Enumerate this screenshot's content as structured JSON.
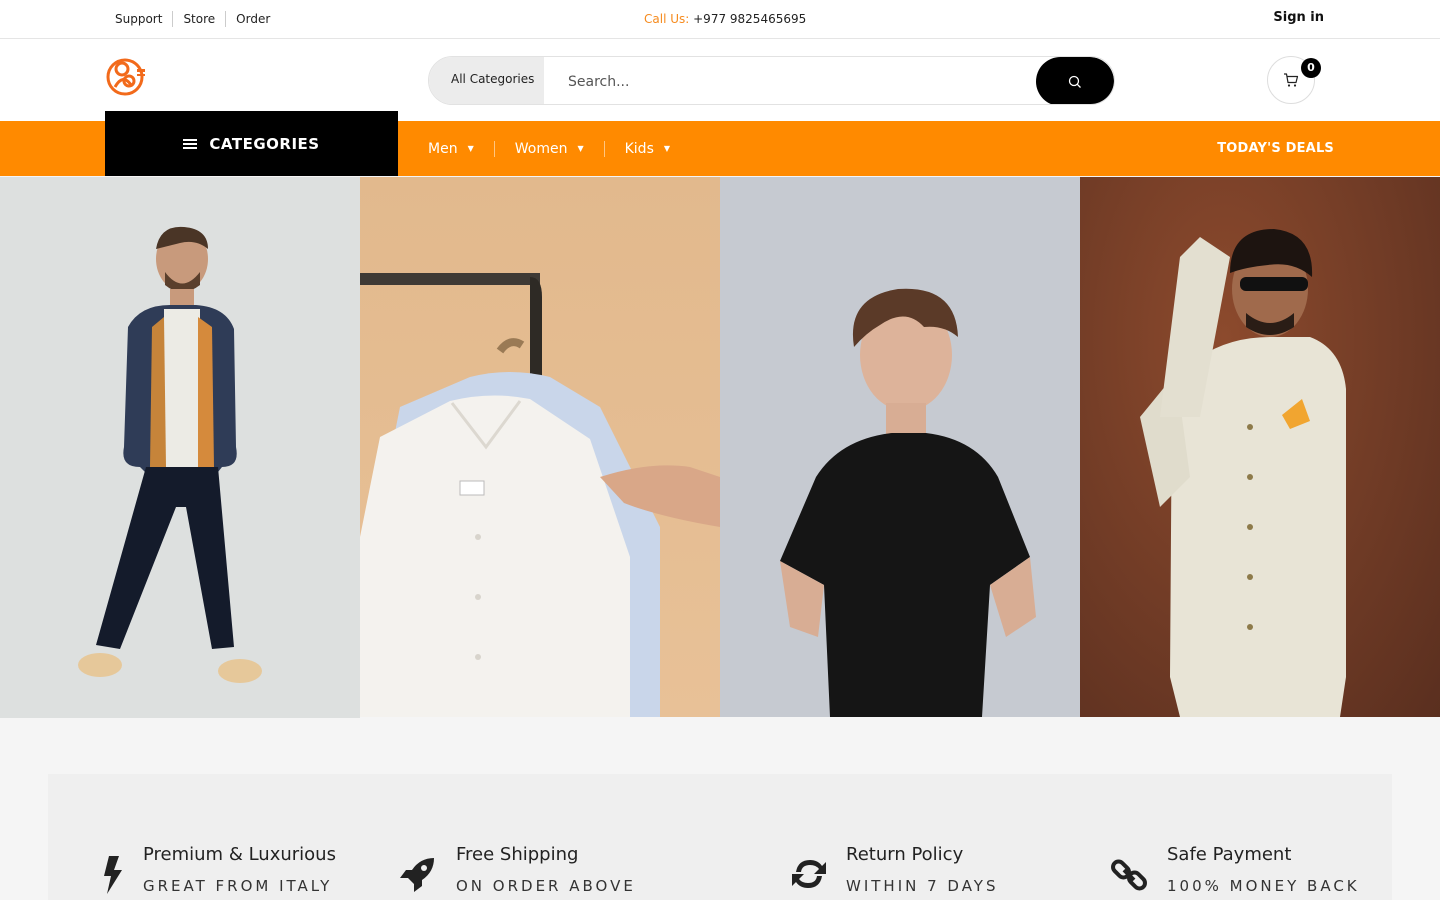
{
  "topbar": {
    "links": [
      "Support",
      "Store",
      "Order"
    ],
    "call_label": "Call Us:",
    "phone": "+977 9825465695",
    "signin": "Sign in"
  },
  "header": {
    "logo_icon": "brand-logo",
    "category_select": "All Categories",
    "search_placeholder": "Search...",
    "search_icon": "search-icon",
    "cart_icon": "cart-icon",
    "cart_count": "0"
  },
  "nav": {
    "categories_label": "CATEGORIES",
    "items": [
      {
        "label": "Men"
      },
      {
        "label": "Women"
      },
      {
        "label": "Kids"
      }
    ],
    "deals": "TODAY'S DEALS"
  },
  "colors": {
    "accent": "#ff8a00",
    "dark": "#000000"
  },
  "features": [
    {
      "icon": "bolt-icon",
      "title": "Premium & Luxurious",
      "subtitle": "GREAT FROM ITALY"
    },
    {
      "icon": "rocket-icon",
      "title": "Free Shipping",
      "subtitle": "ON ORDER ABOVE"
    },
    {
      "icon": "refresh-icon",
      "title": "Return Policy",
      "subtitle": "WITHIN 7 DAYS"
    },
    {
      "icon": "link-icon",
      "title": "Safe Payment",
      "subtitle": "100% MONEY BACK"
    }
  ]
}
